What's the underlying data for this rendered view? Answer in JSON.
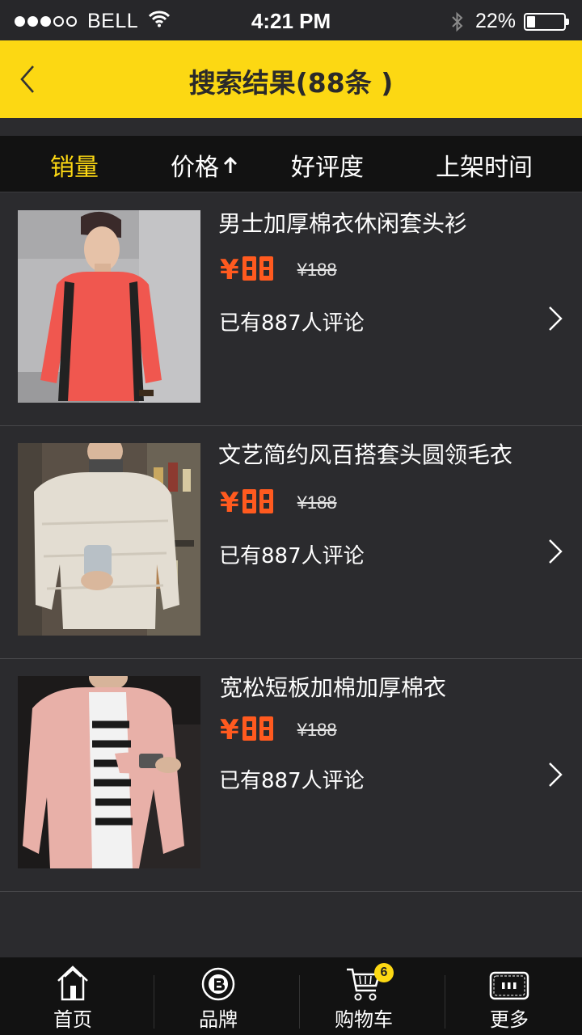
{
  "status_bar": {
    "carrier": "BELL",
    "time": "4:21 PM",
    "battery_percent": "22%",
    "battery_level": 0.22,
    "signal_filled": 3,
    "signal_total": 5
  },
  "header": {
    "title": "搜索结果(88条 )",
    "back_icon": "chevron-left-icon",
    "background": "#fcd813"
  },
  "sort_bar": {
    "items": [
      {
        "label": "销量",
        "active": true
      },
      {
        "label": "价格",
        "icon": "arrow-up-icon"
      },
      {
        "label": "好评度"
      },
      {
        "label": "上架时间"
      }
    ]
  },
  "products": [
    {
      "name": "男士加厚棉衣休闲套头衫",
      "price_symbol": "¥",
      "price": "88",
      "old_price": "¥188",
      "reviews": "已有887人评论"
    },
    {
      "name": "文艺简约风百搭套头圆领毛衣",
      "price_symbol": "¥",
      "price": "88",
      "old_price": "¥188",
      "reviews": "已有887人评论"
    },
    {
      "name": "宽松短板加棉加厚棉衣",
      "price_symbol": "¥",
      "price": "88",
      "old_price": "¥188",
      "reviews": "已有887人评论"
    }
  ],
  "tab_bar": {
    "tabs": [
      {
        "label": "首页",
        "icon": "home-icon"
      },
      {
        "label": "品牌",
        "icon": "brand-icon"
      },
      {
        "label": "购物车",
        "icon": "cart-icon",
        "badge": "6"
      },
      {
        "label": "更多",
        "icon": "more-icon"
      }
    ]
  },
  "colors": {
    "accent": "#fcd813",
    "price": "#ff5a1f",
    "background": "#2b2b2e",
    "bar": "#121212"
  }
}
